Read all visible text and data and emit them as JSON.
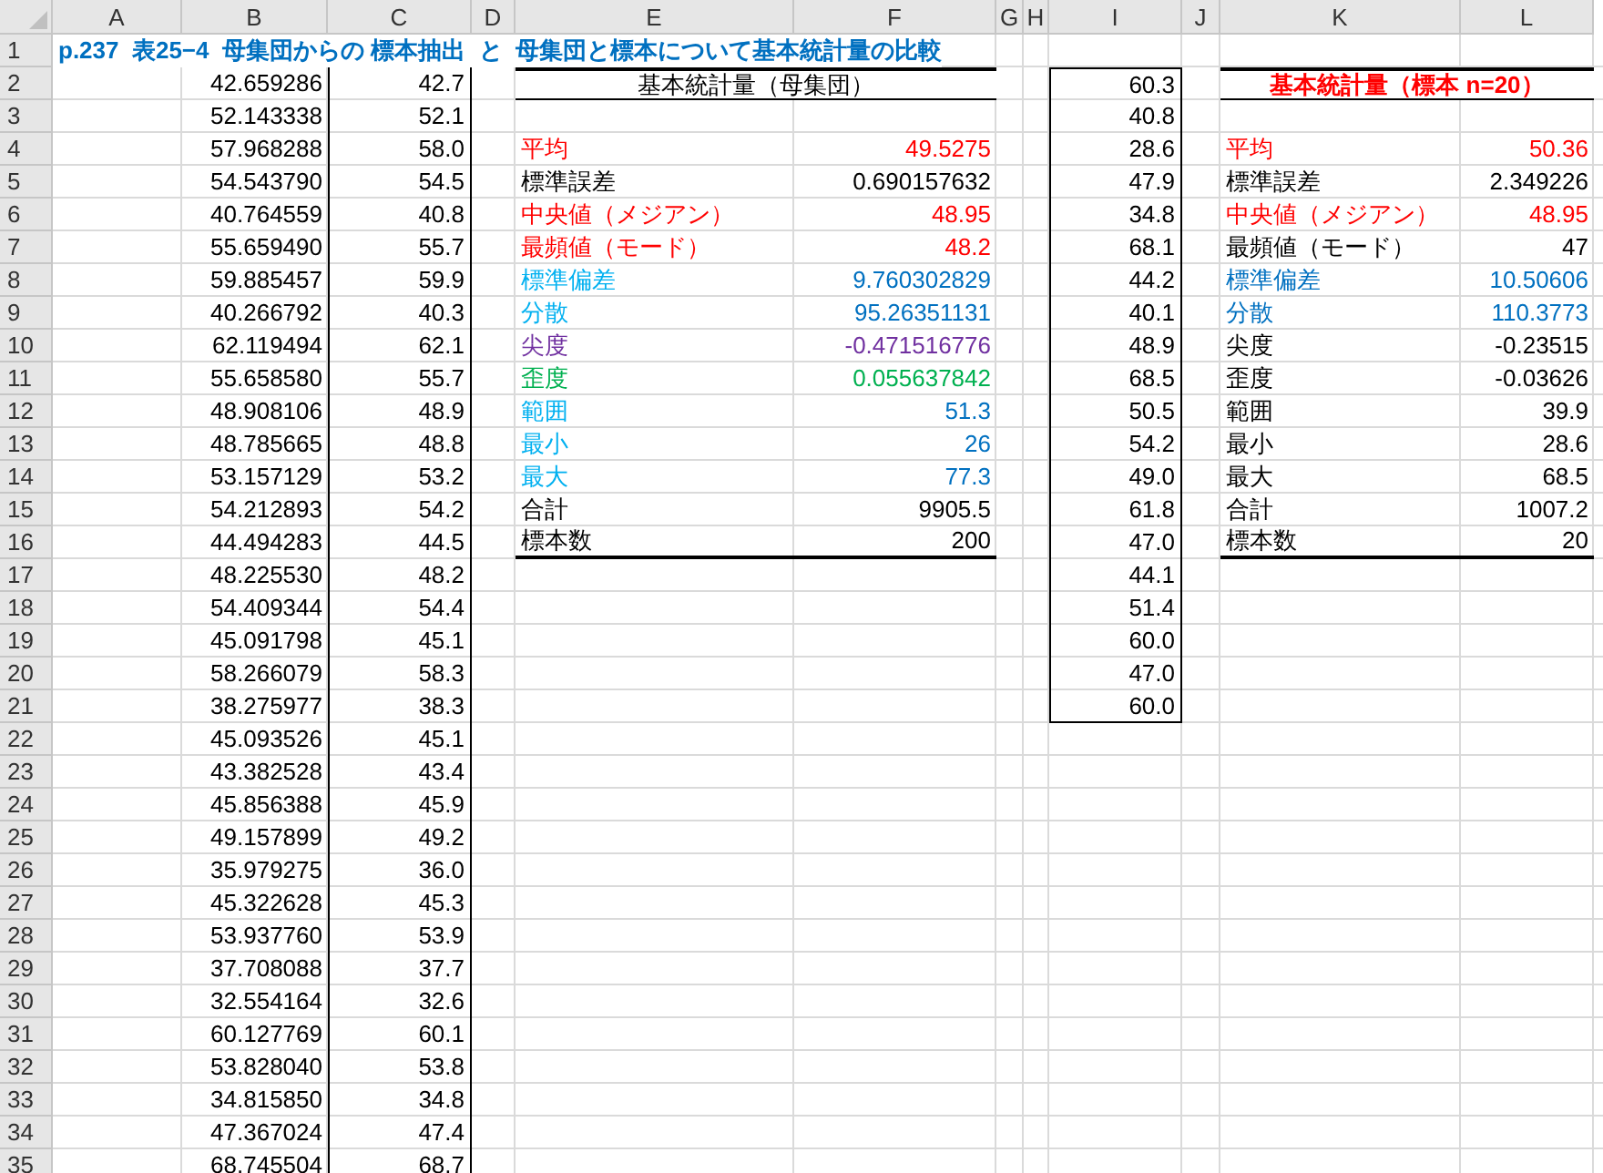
{
  "column_headers": [
    "A",
    "B",
    "C",
    "D",
    "E",
    "F",
    "G",
    "H",
    "I",
    "J",
    "K",
    "L"
  ],
  "row_numbers": [
    "1",
    "2",
    "3",
    "4",
    "5",
    "6",
    "7",
    "8",
    "9",
    "10",
    "11",
    "12",
    "13",
    "14",
    "15",
    "16",
    "17",
    "18",
    "19",
    "20",
    "21",
    "22",
    "23",
    "24",
    "25",
    "26",
    "27",
    "28",
    "29",
    "30",
    "31",
    "32",
    "33",
    "34",
    "35"
  ],
  "title": "p.237  表25−4  母集団からの 標本抽出  と  母集団と標本について基本統計量の比較",
  "data_rows": [
    {
      "b": "42.659286",
      "c": "42.7"
    },
    {
      "b": "52.143338",
      "c": "52.1"
    },
    {
      "b": "57.968288",
      "c": "58.0"
    },
    {
      "b": "54.543790",
      "c": "54.5"
    },
    {
      "b": "40.764559",
      "c": "40.8"
    },
    {
      "b": "55.659490",
      "c": "55.7"
    },
    {
      "b": "59.885457",
      "c": "59.9"
    },
    {
      "b": "40.266792",
      "c": "40.3"
    },
    {
      "b": "62.119494",
      "c": "62.1"
    },
    {
      "b": "55.658580",
      "c": "55.7"
    },
    {
      "b": "48.908106",
      "c": "48.9"
    },
    {
      "b": "48.785665",
      "c": "48.8"
    },
    {
      "b": "53.157129",
      "c": "53.2"
    },
    {
      "b": "54.212893",
      "c": "54.2"
    },
    {
      "b": "44.494283",
      "c": "44.5"
    },
    {
      "b": "48.225530",
      "c": "48.2"
    },
    {
      "b": "54.409344",
      "c": "54.4"
    },
    {
      "b": "45.091798",
      "c": "45.1"
    },
    {
      "b": "58.266079",
      "c": "58.3"
    },
    {
      "b": "38.275977",
      "c": "38.3"
    },
    {
      "b": "45.093526",
      "c": "45.1"
    },
    {
      "b": "43.382528",
      "c": "43.4"
    },
    {
      "b": "45.856388",
      "c": "45.9"
    },
    {
      "b": "49.157899",
      "c": "49.2"
    },
    {
      "b": "35.979275",
      "c": "36.0"
    },
    {
      "b": "45.322628",
      "c": "45.3"
    },
    {
      "b": "53.937760",
      "c": "53.9"
    },
    {
      "b": "37.708088",
      "c": "37.7"
    },
    {
      "b": "32.554164",
      "c": "32.6"
    },
    {
      "b": "60.127769",
      "c": "60.1"
    },
    {
      "b": "53.828040",
      "c": "53.8"
    },
    {
      "b": "34.815850",
      "c": "34.8"
    },
    {
      "b": "47.367024",
      "c": "47.4"
    },
    {
      "b": "68.745504",
      "c": "68.7"
    }
  ],
  "population_stats": {
    "heading": "基本統計量（母集団）",
    "rows": [
      {
        "label": {
          "text": "平均",
          "color": "#ff0000"
        },
        "value": {
          "text": "49.5275",
          "color": "#ff0000"
        }
      },
      {
        "label": {
          "text": "標準誤差",
          "color": "#000000"
        },
        "value": {
          "text": "0.690157632",
          "color": "#000000"
        }
      },
      {
        "label": {
          "text": "中央値（メジアン）",
          "color": "#ff0000"
        },
        "value": {
          "text": "48.95",
          "color": "#ff0000"
        }
      },
      {
        "label": {
          "text": "最頻値（モード）",
          "color": "#ff0000"
        },
        "value": {
          "text": "48.2",
          "color": "#ff0000"
        }
      },
      {
        "label": {
          "text": "標準偏差",
          "color": "#00b0f0"
        },
        "value": {
          "text": "9.760302829",
          "color": "#0070c0"
        }
      },
      {
        "label": {
          "text": "分散",
          "color": "#00b0f0"
        },
        "value": {
          "text": "95.26351131",
          "color": "#0070c0"
        }
      },
      {
        "label": {
          "text": "尖度",
          "color": "#7030a0"
        },
        "value": {
          "text": "-0.471516776",
          "color": "#7030a0"
        }
      },
      {
        "label": {
          "text": "歪度",
          "color": "#00b050"
        },
        "value": {
          "text": "0.055637842",
          "color": "#00b050"
        }
      },
      {
        "label": {
          "text": "範囲",
          "color": "#00b0f0"
        },
        "value": {
          "text": "51.3",
          "color": "#0070c0"
        }
      },
      {
        "label": {
          "text": "最小",
          "color": "#00b0f0"
        },
        "value": {
          "text": "26",
          "color": "#0070c0"
        }
      },
      {
        "label": {
          "text": "最大",
          "color": "#00b0f0"
        },
        "value": {
          "text": "77.3",
          "color": "#0070c0"
        }
      },
      {
        "label": {
          "text": "合計",
          "color": "#000000"
        },
        "value": {
          "text": "9905.5",
          "color": "#000000"
        }
      },
      {
        "label": {
          "text": "標本数",
          "color": "#000000"
        },
        "value": {
          "text": "200",
          "color": "#000000"
        }
      }
    ]
  },
  "sample_values": [
    "60.3",
    "40.8",
    "28.6",
    "47.9",
    "34.8",
    "68.1",
    "44.2",
    "40.1",
    "48.9",
    "68.5",
    "50.5",
    "54.2",
    "49.0",
    "61.8",
    "47.0",
    "44.1",
    "51.4",
    "60.0",
    "47.0",
    "60.0"
  ],
  "sample_stats": {
    "heading": "基本統計量（標本  n=20）",
    "rows": [
      {
        "label": {
          "text": "平均",
          "color": "#ff0000"
        },
        "value": {
          "text": "50.36",
          "color": "#ff0000"
        }
      },
      {
        "label": {
          "text": "標準誤差",
          "color": "#000000"
        },
        "value": {
          "text": "2.349226",
          "color": "#000000"
        }
      },
      {
        "label": {
          "text": "中央値（メジアン）",
          "color": "#ff0000"
        },
        "value": {
          "text": "48.95",
          "color": "#ff0000"
        }
      },
      {
        "label": {
          "text": "最頻値（モード）",
          "color": "#000000"
        },
        "value": {
          "text": "47",
          "color": "#000000"
        }
      },
      {
        "label": {
          "text": "標準偏差",
          "color": "#0070c0"
        },
        "value": {
          "text": "10.50606",
          "color": "#0070c0"
        }
      },
      {
        "label": {
          "text": "分散",
          "color": "#0070c0"
        },
        "value": {
          "text": "110.3773",
          "color": "#0070c0"
        }
      },
      {
        "label": {
          "text": "尖度",
          "color": "#000000"
        },
        "value": {
          "text": "-0.23515",
          "color": "#000000"
        }
      },
      {
        "label": {
          "text": "歪度",
          "color": "#000000"
        },
        "value": {
          "text": "-0.03626",
          "color": "#000000"
        }
      },
      {
        "label": {
          "text": "範囲",
          "color": "#000000"
        },
        "value": {
          "text": "39.9",
          "color": "#000000"
        }
      },
      {
        "label": {
          "text": "最小",
          "color": "#000000"
        },
        "value": {
          "text": "28.6",
          "color": "#000000"
        }
      },
      {
        "label": {
          "text": "最大",
          "color": "#000000"
        },
        "value": {
          "text": "68.5",
          "color": "#000000"
        }
      },
      {
        "label": {
          "text": "合計",
          "color": "#000000"
        },
        "value": {
          "text": "1007.2",
          "color": "#000000"
        }
      },
      {
        "label": {
          "text": "標本数",
          "color": "#000000"
        },
        "value": {
          "text": "20",
          "color": "#000000"
        }
      }
    ]
  }
}
